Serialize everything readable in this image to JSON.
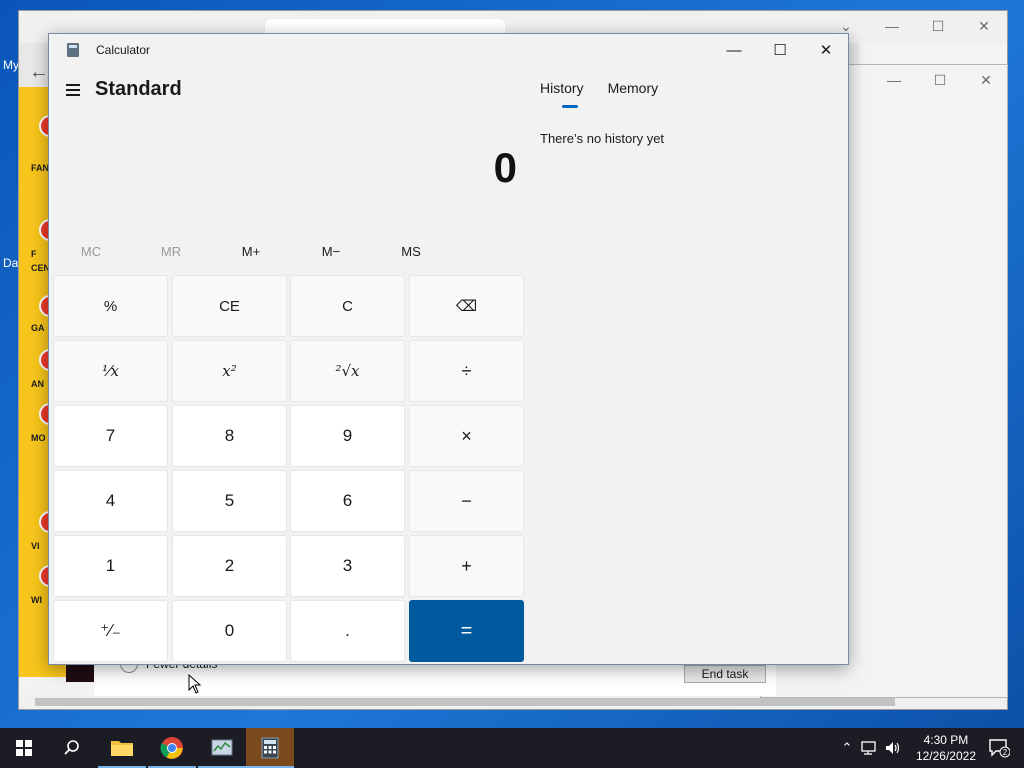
{
  "desktop": {
    "label_my": "My",
    "label_da": "Da"
  },
  "browser": {
    "sidebar_labels": [
      "FAN",
      "F",
      "CEN",
      "GA",
      "AN",
      "MO",
      "VI",
      "WI"
    ]
  },
  "taskmgr": {
    "fewer_details_label": "Fewer details",
    "end_task_label": "End task"
  },
  "calculator": {
    "title": "Calculator",
    "mode": "Standard",
    "display_value": "0",
    "memory_buttons": [
      {
        "label": "MC",
        "enabled": false
      },
      {
        "label": "MR",
        "enabled": false
      },
      {
        "label": "M+",
        "enabled": true
      },
      {
        "label": "M−",
        "enabled": true
      },
      {
        "label": "MS",
        "enabled": true
      }
    ],
    "tabs": {
      "history": "History",
      "memory": "Memory"
    },
    "history_empty_text": "There’s no history yet",
    "keys": {
      "percent": "%",
      "ce": "CE",
      "c": "C",
      "backspace": "⌫",
      "reciprocal": "⅟x",
      "square": "x²",
      "sqrt": "²√x",
      "divide": "÷",
      "seven": "7",
      "eight": "8",
      "nine": "9",
      "multiply": "×",
      "four": "4",
      "five": "5",
      "six": "6",
      "minus": "−",
      "one": "1",
      "two": "2",
      "three": "3",
      "plus": "+",
      "negate": "⁺∕₋",
      "zero": "0",
      "decimal": ".",
      "equals": "="
    },
    "accent_color": "#005a9e"
  },
  "taskbar": {
    "time": "4:30 PM",
    "date": "12/26/2022",
    "notification_count": "2"
  }
}
